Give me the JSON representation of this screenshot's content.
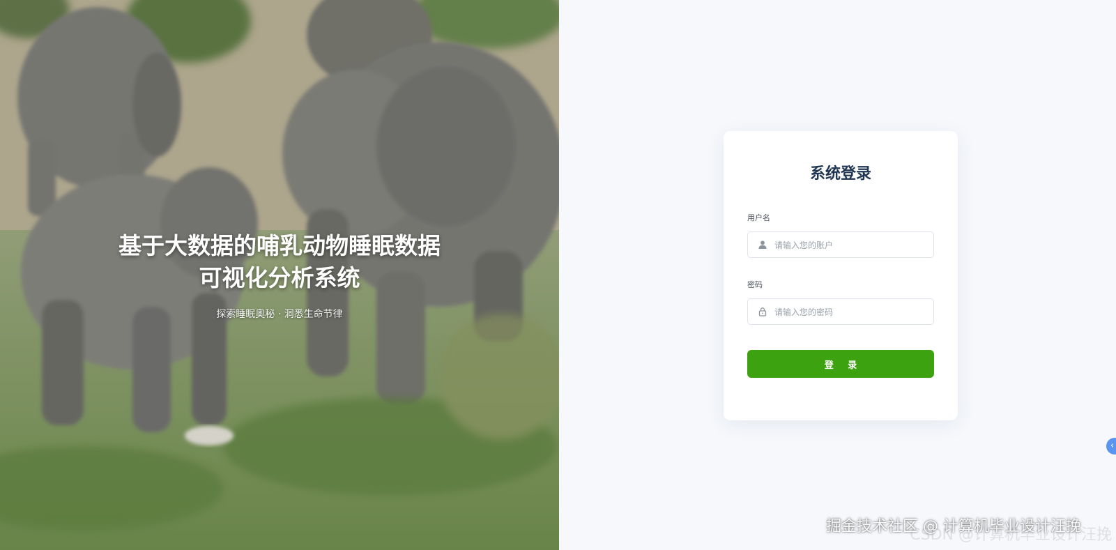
{
  "hero": {
    "title_line1": "基于大数据的哺乳动物睡眠数据",
    "title_line2": "可视化分析系统",
    "subtitle": "探索睡眠奥秘 · 洞悉生命节律",
    "background_image": "elephant-herd-photo"
  },
  "login": {
    "title": "系统登录",
    "username_label": "用户名",
    "username_placeholder": "请输入您的账户",
    "username_icon": "user-icon",
    "password_label": "密码",
    "password_placeholder": "请输入您的密码",
    "password_icon": "lock-icon",
    "submit_label": "登 录",
    "submit_color": "#3ca20f"
  },
  "side_handle": {
    "icon": "chevron-left-icon",
    "color": "#5b95ef"
  },
  "watermark": {
    "text": "掘金技术社区 @ 计算机毕业设计汪挽",
    "faint_text": "CSDN @计算机毕业设计汪挽"
  },
  "colors": {
    "page_bg": "#f6f8fc",
    "title_color": "#1f3552",
    "accent_green": "#3ca20f"
  }
}
